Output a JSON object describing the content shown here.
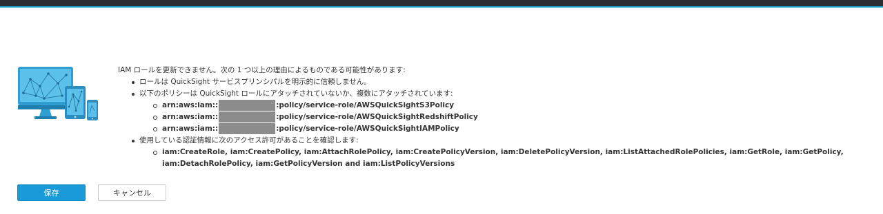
{
  "error": {
    "intro": "IAM ロールを更新できません。次の 1 つ以上の理由によるものである可能性があります:",
    "reasons": [
      "ロールは QuickSight サービスプリンシパルを明示的に信頼しません。",
      "以下のポリシーは QuickSight ロールにアタッチされていないか、複数にアタッチされています:",
      "使用している認証情報に次のアクセス許可があることを確認します:"
    ],
    "arn_prefix": "arn:aws:iam::",
    "policies": [
      ":policy/service-role/AWSQuickSightS3Policy",
      ":policy/service-role/AWSQuickSightRedshiftPolicy",
      ":policy/service-role/AWSQuickSightIAMPolicy"
    ],
    "permissions": "iam:CreateRole, iam:CreatePolicy, iam:AttachRolePolicy, iam:CreatePolicyVersion, iam:DeletePolicyVersion, iam:ListAttachedRolePolicies, iam:GetRole, iam:GetPolicy, iam:DetachRolePolicy, iam:GetPolicyVersion and iam:ListPolicyVersions"
  },
  "buttons": {
    "save": "保存",
    "cancel": "キャンセル"
  },
  "colors": {
    "accent": "#1a9bd8",
    "top_bar": "#2c2d2f",
    "top_line": "#1f9ec5",
    "redaction": "#8c8c8c"
  },
  "icons": {
    "illustration": "devices-network-icon"
  }
}
